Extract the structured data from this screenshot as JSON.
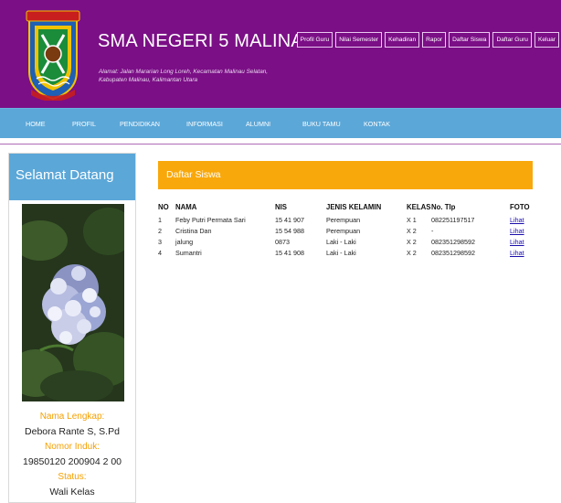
{
  "colors": {
    "header_bg": "#7b0f86",
    "nav_bg": "#5ba7d8",
    "panel_accent": "#f9a80b",
    "label_accent": "#f5a000"
  },
  "header": {
    "logo_text": "KABUPATEN MALINAU",
    "school_name": "SMA NEGERI 5 MALINAU",
    "address_line1": "Alamat: Jalan Mararian Long Loreh, Kecamatan Malinau Selatan,",
    "address_line2": "Kabupaten Malinau, Kalimantan Utara"
  },
  "top_menu": [
    "Profil Guru",
    "Nilai Semester",
    "Kehadiran",
    "Rapor",
    "Daftar Siswa",
    "Daftar Guru",
    "Keluar"
  ],
  "main_nav": [
    "HOME",
    "PROFIL",
    "PENDIDIKAN",
    "INFORMASI",
    "ALUMNI",
    "BUKU TAMU",
    "KONTAK"
  ],
  "sidebar": {
    "title": "Selamat Datang",
    "name_label": "Nama Lengkap:",
    "name_value": "Debora Rante S, S.Pd",
    "nip_label": "Nomor Induk:",
    "nip_value": "19850120 200904 2 00",
    "status_label": "Status:",
    "status_value": "Wali Kelas"
  },
  "panel": {
    "title": "Daftar Siswa",
    "columns": [
      "NO",
      "NAMA",
      "NIS",
      "JENIS KELAMIN",
      "KELAS",
      "No. Tlp",
      "FOTO"
    ],
    "rows": [
      {
        "no": "1",
        "nama": "Feby Putri Permata Sari",
        "nis": "15 41 907",
        "jk": "Perempuan",
        "kelas": "X 1",
        "tlp": "082251197517",
        "foto": "Lihat"
      },
      {
        "no": "2",
        "nama": "Cristina Dan",
        "nis": "15 54 988",
        "jk": "Perempuan",
        "kelas": "X 2",
        "tlp": "-",
        "foto": "Lihat"
      },
      {
        "no": "3",
        "nama": "jalung",
        "nis": "0873",
        "jk": "Laki - Laki",
        "kelas": "X 2",
        "tlp": "082351298592",
        "foto": "Lihat"
      },
      {
        "no": "4",
        "nama": "Sumantri",
        "nis": "15 41 908",
        "jk": "Laki - Laki",
        "kelas": "X 2",
        "tlp": "082351298592",
        "foto": "Lihat"
      }
    ]
  }
}
